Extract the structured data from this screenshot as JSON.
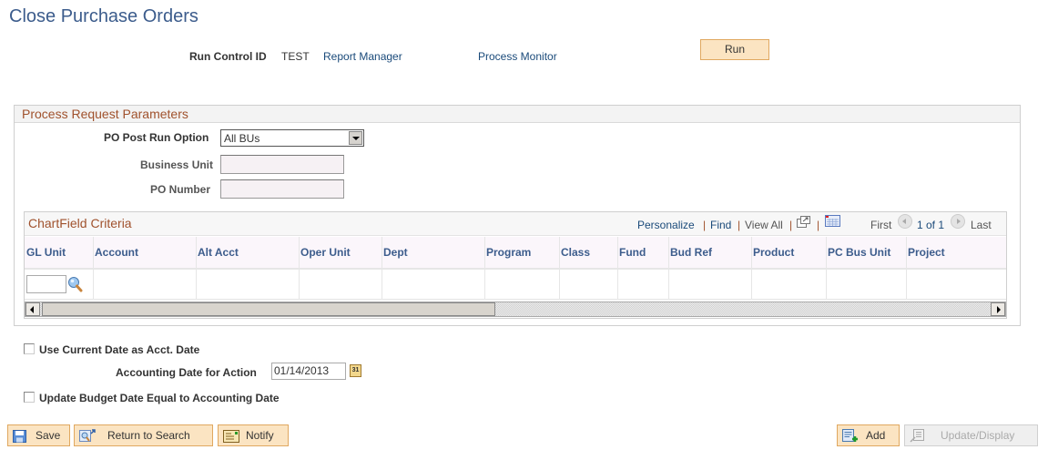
{
  "page": {
    "title": "Close Purchase Orders"
  },
  "run_control": {
    "label": "Run Control ID",
    "value": "TEST",
    "report_manager_link": "Report Manager",
    "process_monitor_link": "Process Monitor",
    "run_button": "Run"
  },
  "process_request": {
    "title": "Process Request Parameters",
    "po_post_run_option": {
      "label": "PO Post Run Option",
      "value": "All BUs"
    },
    "business_unit": {
      "label": "Business Unit",
      "value": ""
    },
    "po_number": {
      "label": "PO Number",
      "value": ""
    }
  },
  "chartfield_grid": {
    "title": "ChartField Criteria",
    "nav": {
      "personalize": "Personalize",
      "find": "Find",
      "view_all": "View All",
      "separator": "|",
      "first": "First",
      "page_info": "1 of 1",
      "last": "Last"
    },
    "columns": [
      "GL Unit",
      "Account",
      "Alt Acct",
      "Oper Unit",
      "Dept",
      "Program",
      "Class",
      "Fund",
      "Bud Ref",
      "Product",
      "PC Bus Unit",
      "Project"
    ],
    "rows": [
      {
        "gl_unit": ""
      }
    ]
  },
  "options": {
    "use_current_date": {
      "label": "Use Current Date as Acct. Date",
      "checked": false
    },
    "accounting_date": {
      "label": "Accounting Date for Action",
      "value": "01/14/2013",
      "calendar_glyph": "31"
    },
    "update_budget_date": {
      "label": "Update Budget Date Equal to Accounting Date",
      "checked": false
    }
  },
  "toolbar": {
    "save": "Save",
    "return_to_search": "Return to Search",
    "notify": "Notify",
    "add": "Add",
    "update_display": "Update/Display"
  },
  "colors": {
    "title": "#3c5c8c",
    "link": "#1a4a7a",
    "group_title": "#a0522d",
    "button_bg": "#fbe4c2",
    "button_border": "#e0a860"
  }
}
